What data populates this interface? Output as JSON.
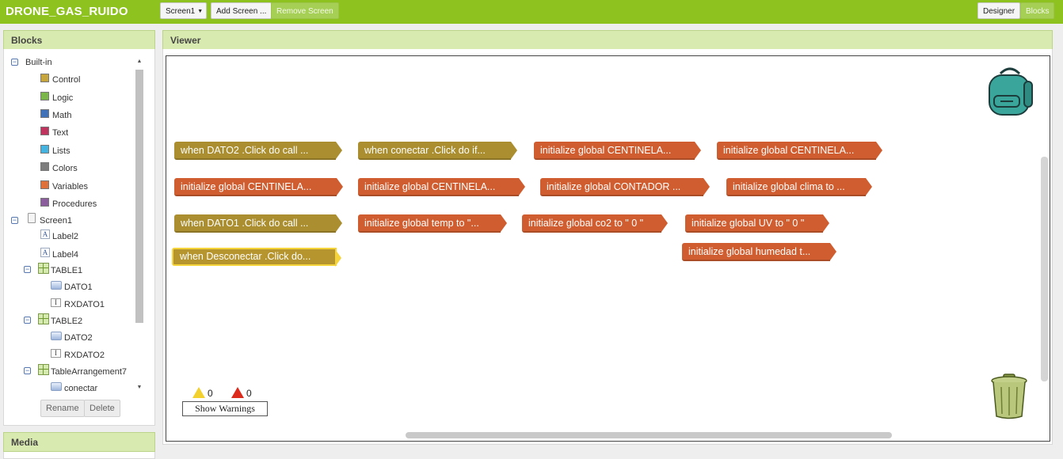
{
  "app": {
    "title": "DRONE_GAS_RUIDO",
    "screen_select": "Screen1",
    "add_screen": "Add Screen ...",
    "remove_screen": "Remove Screen",
    "designer": "Designer",
    "blocks": "Blocks"
  },
  "blocks_panel": {
    "header": "Blocks",
    "builtin_label": "Built-in",
    "builtin": [
      {
        "label": "Control",
        "color": "#c7a53d"
      },
      {
        "label": "Logic",
        "color": "#7ab648"
      },
      {
        "label": "Math",
        "color": "#3f72b9"
      },
      {
        "label": "Text",
        "color": "#c0335e"
      },
      {
        "label": "Lists",
        "color": "#45b3e0"
      },
      {
        "label": "Colors",
        "color": "#7d7d7d"
      },
      {
        "label": "Variables",
        "color": "#e0703a"
      },
      {
        "label": "Procedures",
        "color": "#8b5d9c"
      }
    ],
    "components": {
      "screen": "Screen1",
      "label2": "Label2",
      "label4": "Label4",
      "table1": "TABLE1",
      "dato1": "DATO1",
      "rxdato1": "RXDATO1",
      "table2": "TABLE2",
      "dato2": "DATO2",
      "rxdato2": "RXDATO2",
      "table7": "TableArrangement7",
      "conectar": "conectar"
    },
    "rename": "Rename",
    "delete": "Delete"
  },
  "media_panel": {
    "header": "Media"
  },
  "viewer": {
    "header": "Viewer",
    "blocks": [
      {
        "kind": "event",
        "text": "when  DATO2 .Click do call ..."
      },
      {
        "kind": "event",
        "text": "when  conectar .Click do if..."
      },
      {
        "kind": "global",
        "text": "initialize global CENTINELA..."
      },
      {
        "kind": "global",
        "text": "initialize global CENTINELA..."
      },
      {
        "kind": "global",
        "text": "initialize global CENTINELA..."
      },
      {
        "kind": "global",
        "text": "initialize global CENTINELA..."
      },
      {
        "kind": "global",
        "text": "initialize global CONTADOR ..."
      },
      {
        "kind": "global",
        "text": "initialize global clima to ..."
      },
      {
        "kind": "event",
        "text": "when  DATO1 .Click do call ..."
      },
      {
        "kind": "global",
        "text": "initialize global temp to \"..."
      },
      {
        "kind": "global",
        "text": "initialize global co2 to \" 0 \""
      },
      {
        "kind": "global",
        "text": "initialize global UV to \" 0 \""
      },
      {
        "kind": "event",
        "text": "when  Desconectar .Click do..."
      },
      {
        "kind": "global",
        "text": "initialize global humedad t..."
      }
    ],
    "warnings_count": "0",
    "errors_count": "0",
    "show_warnings": "Show Warnings"
  },
  "colors": {
    "topbar": "#8dc21f",
    "event_block": "#aa8e2f",
    "global_block": "#d05d2f"
  },
  "icons": [
    "backpack-icon",
    "trash-icon",
    "warning-icon",
    "error-icon"
  ]
}
